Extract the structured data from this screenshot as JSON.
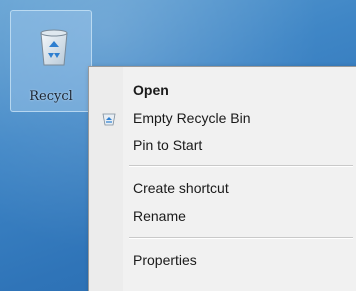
{
  "desktop": {
    "icon": {
      "label": "Recycl",
      "icon_name": "recycle-bin-icon"
    }
  },
  "context_menu": {
    "items": [
      {
        "label": "Open",
        "bold": true,
        "icon": null
      },
      {
        "label": "Empty Recycle Bin",
        "bold": false,
        "icon": "recycle-shield-icon"
      },
      {
        "label": "Pin to Start",
        "bold": false,
        "icon": null
      },
      {
        "label": "Create shortcut",
        "bold": false,
        "icon": null
      },
      {
        "label": "Rename",
        "bold": false,
        "icon": null
      },
      {
        "label": "Properties",
        "bold": false,
        "icon": null
      }
    ]
  },
  "colors": {
    "desktop_background": "#3f86c6",
    "menu_background": "#f1f1f1",
    "menu_text": "#1a1a1a"
  }
}
